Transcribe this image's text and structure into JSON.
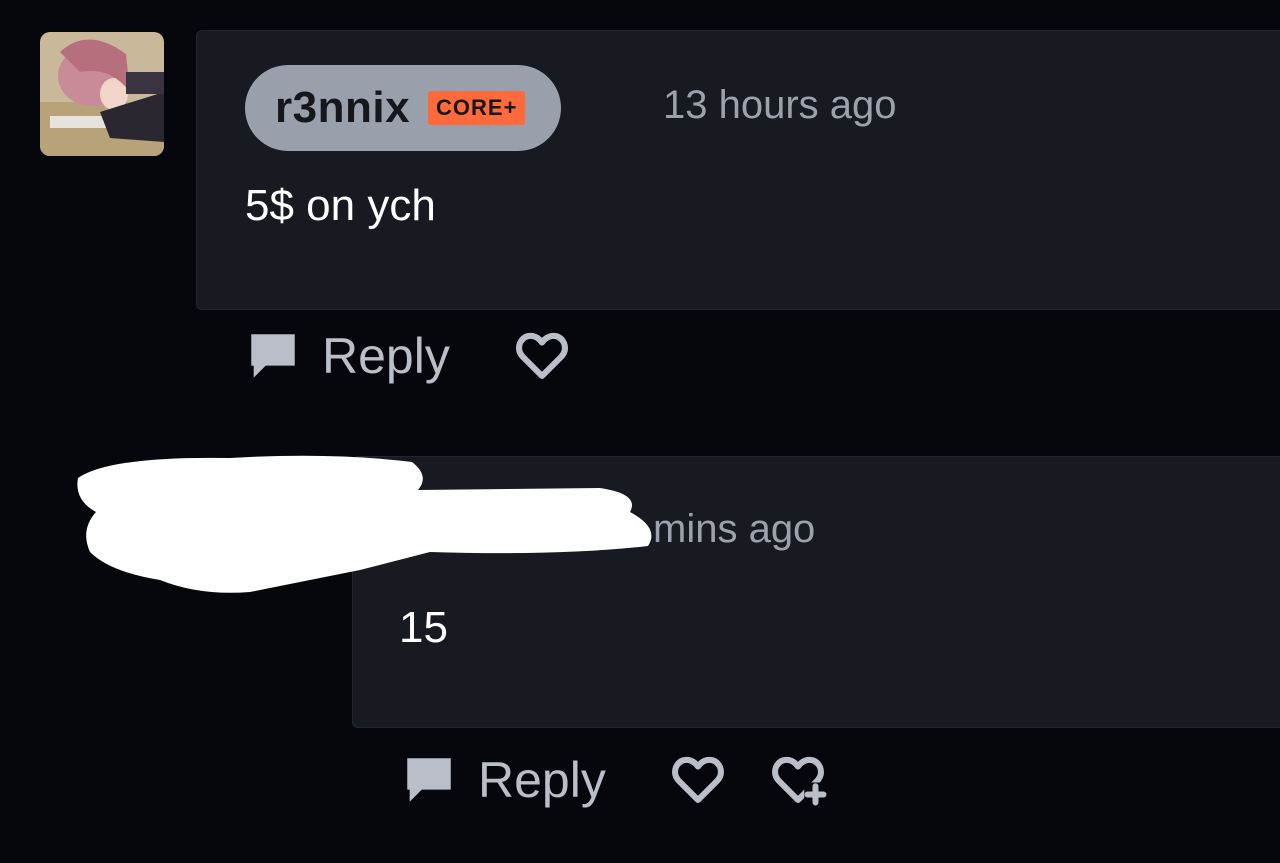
{
  "comments": [
    {
      "username": "r3nnix",
      "badge": "CORE+",
      "timestamp": "13 hours ago",
      "body": "5$ on ych",
      "reply_label": "Reply"
    },
    {
      "timestamp": "mins ago",
      "body": "15",
      "reply_label": "Reply"
    }
  ],
  "colors": {
    "background": "#06070c",
    "card": "#171a21",
    "user_pill": "#9aa0ab",
    "badge": "#ff6a3d",
    "muted_text": "#9ca1ab",
    "action_text": "#b9bec8"
  },
  "icons": {
    "reply": "speech-bubble-icon",
    "like": "heart-outline-icon",
    "react": "heart-plus-icon"
  }
}
